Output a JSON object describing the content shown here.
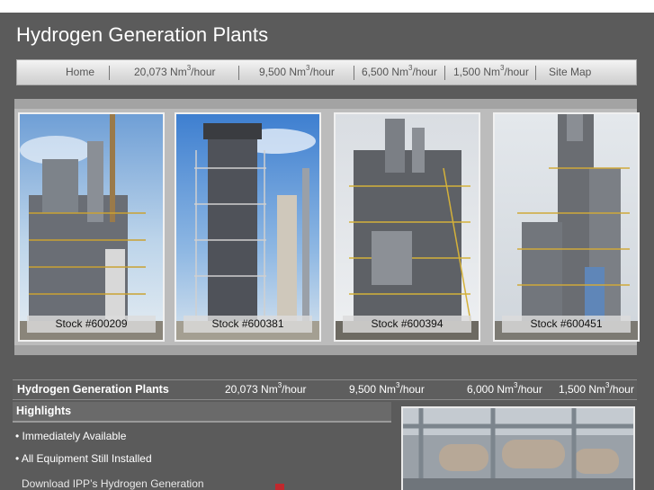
{
  "page_title": "Hydrogen Generation Plants",
  "nav": {
    "home": "Home",
    "item1": "20,073 Nm",
    "item2": "9,500 Nm",
    "item3": "6,500 Nm",
    "item4": "1,500 Nm",
    "sitemap": "Site Map",
    "sup": "3",
    "suffix": "/hour"
  },
  "gallery": [
    {
      "label": "Stock #600209"
    },
    {
      "label": "Stock #600381"
    },
    {
      "label": "Stock #600394"
    },
    {
      "label": "Stock #600451"
    }
  ],
  "table": {
    "title": "Hydrogen Generation Plants",
    "col1": "20,073 Nm",
    "col2": "9,500 Nm",
    "col3": "6,000 Nm",
    "col4": "1,500 Nm",
    "sup": "3",
    "suffix": "/hour"
  },
  "highlights": {
    "title": "Highlights",
    "items": [
      "• Immediately Available",
      "• All Equipment Still Installed"
    ],
    "download": "Download IPP’s Hydrogen Generation"
  }
}
